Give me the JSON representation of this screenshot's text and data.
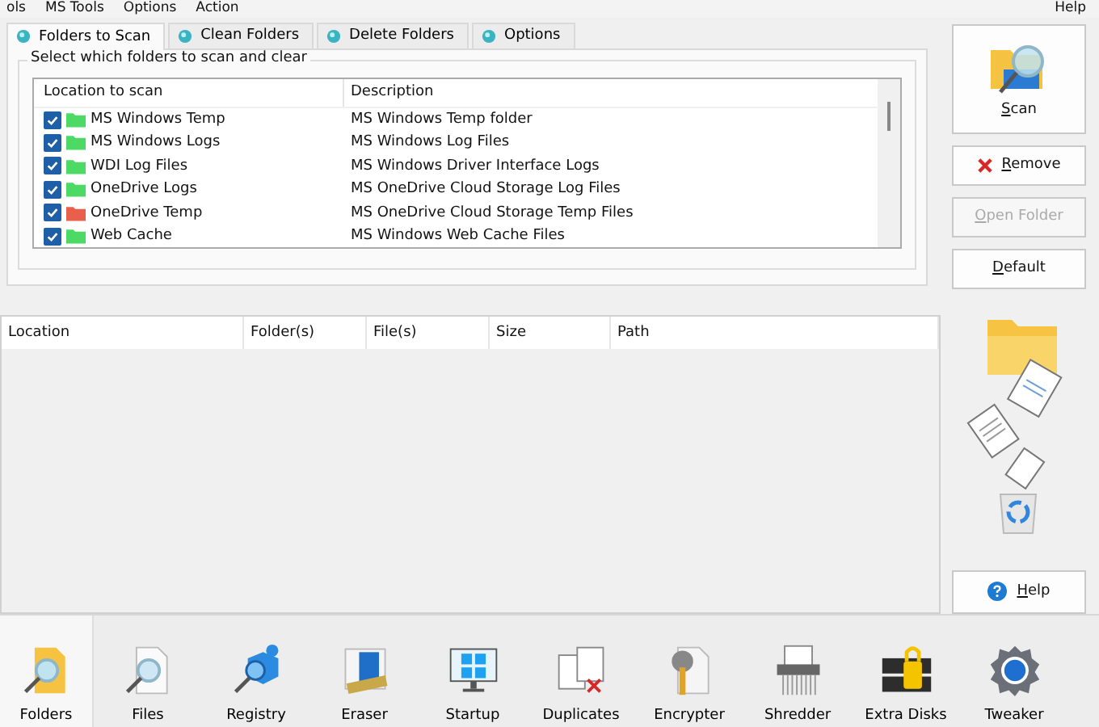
{
  "menu": [
    "ols",
    "MS Tools",
    "Options",
    "Action"
  ],
  "menu_help": "Help",
  "tabs": [
    {
      "label": "Folders to Scan",
      "selected": true
    },
    {
      "label": "Clean Folders",
      "selected": false
    },
    {
      "label": "Delete Folders",
      "selected": false
    },
    {
      "label": "Options",
      "selected": false
    }
  ],
  "group_title": "Select which folders to scan and clear",
  "scan_list": {
    "columns": [
      "Location to scan",
      "Description"
    ],
    "rows": [
      {
        "location": "MS Windows Temp",
        "description": "MS Windows Temp folder",
        "checked": true,
        "color": "#4cd964"
      },
      {
        "location": "MS Windows Logs",
        "description": "MS Windows Log Files",
        "checked": true,
        "color": "#4cd964"
      },
      {
        "location": "WDI Log Files",
        "description": "MS Windows Driver Interface Logs",
        "checked": true,
        "color": "#4cd964"
      },
      {
        "location": "OneDrive Logs",
        "description": "MS OneDrive Cloud Storage Log Files",
        "checked": true,
        "color": "#4cd964"
      },
      {
        "location": "OneDrive Temp",
        "description": "MS OneDrive Cloud Storage Temp Files",
        "checked": true,
        "color": "#e8604c"
      },
      {
        "location": "Web Cache",
        "description": "MS Windows Web Cache Files",
        "checked": true,
        "color": "#4cd964"
      }
    ]
  },
  "results": {
    "columns": [
      "Location",
      "Folder(s)",
      "File(s)",
      "Size",
      "Path"
    ]
  },
  "side_buttons": [
    {
      "label": "Scan",
      "kind": "scan",
      "disabled": false
    },
    {
      "label": "Remove",
      "kind": "remove",
      "disabled": false
    },
    {
      "label": "Open Folder",
      "kind": "plain",
      "disabled": true
    },
    {
      "label": "Default",
      "kind": "plain",
      "disabled": false
    }
  ],
  "help_button": "Help",
  "toolbar": [
    {
      "label": "Folders",
      "selected": true
    },
    {
      "label": "Files",
      "selected": false
    },
    {
      "label": "Registry",
      "selected": false
    },
    {
      "label": "Eraser",
      "selected": false
    },
    {
      "label": "Startup",
      "selected": false
    },
    {
      "label": "Duplicates",
      "selected": false
    },
    {
      "label": "Encrypter",
      "selected": false
    },
    {
      "label": "Shredder",
      "selected": false
    },
    {
      "label": "Extra Disks",
      "selected": false
    },
    {
      "label": "Tweaker",
      "selected": false
    }
  ]
}
